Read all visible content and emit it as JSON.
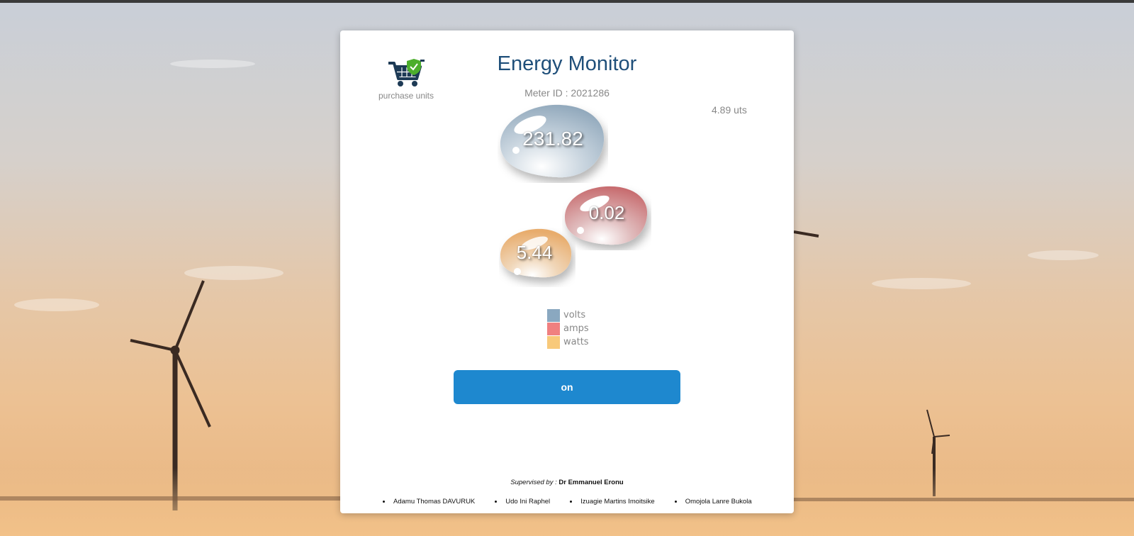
{
  "header": {
    "title": "Energy Monitor",
    "meter_id_label": "Meter ID : 2021286",
    "units_remaining": "4.89 uts"
  },
  "purchase": {
    "label": "purchase units",
    "icon": "shopping-cart-shield-icon"
  },
  "readings": {
    "volts": "231.82",
    "amps": "0.02",
    "watts": "5.44"
  },
  "legend": [
    {
      "label": "volts",
      "color": "#8aa8c0"
    },
    {
      "label": "amps",
      "color": "#f08080"
    },
    {
      "label": "watts",
      "color": "#f8c97a"
    }
  ],
  "power_button": {
    "label": "on",
    "color": "#1e88cf"
  },
  "footer": {
    "supervised_prefix": "Supervised by :",
    "supervisor_name": "Dr Emmanuel Eronu",
    "team": [
      "Adamu Thomas DAVURUK",
      "Udo Ini Raphel",
      "Izuagie Martins Imoitsike",
      "Omojola Lanre Bukola"
    ]
  }
}
